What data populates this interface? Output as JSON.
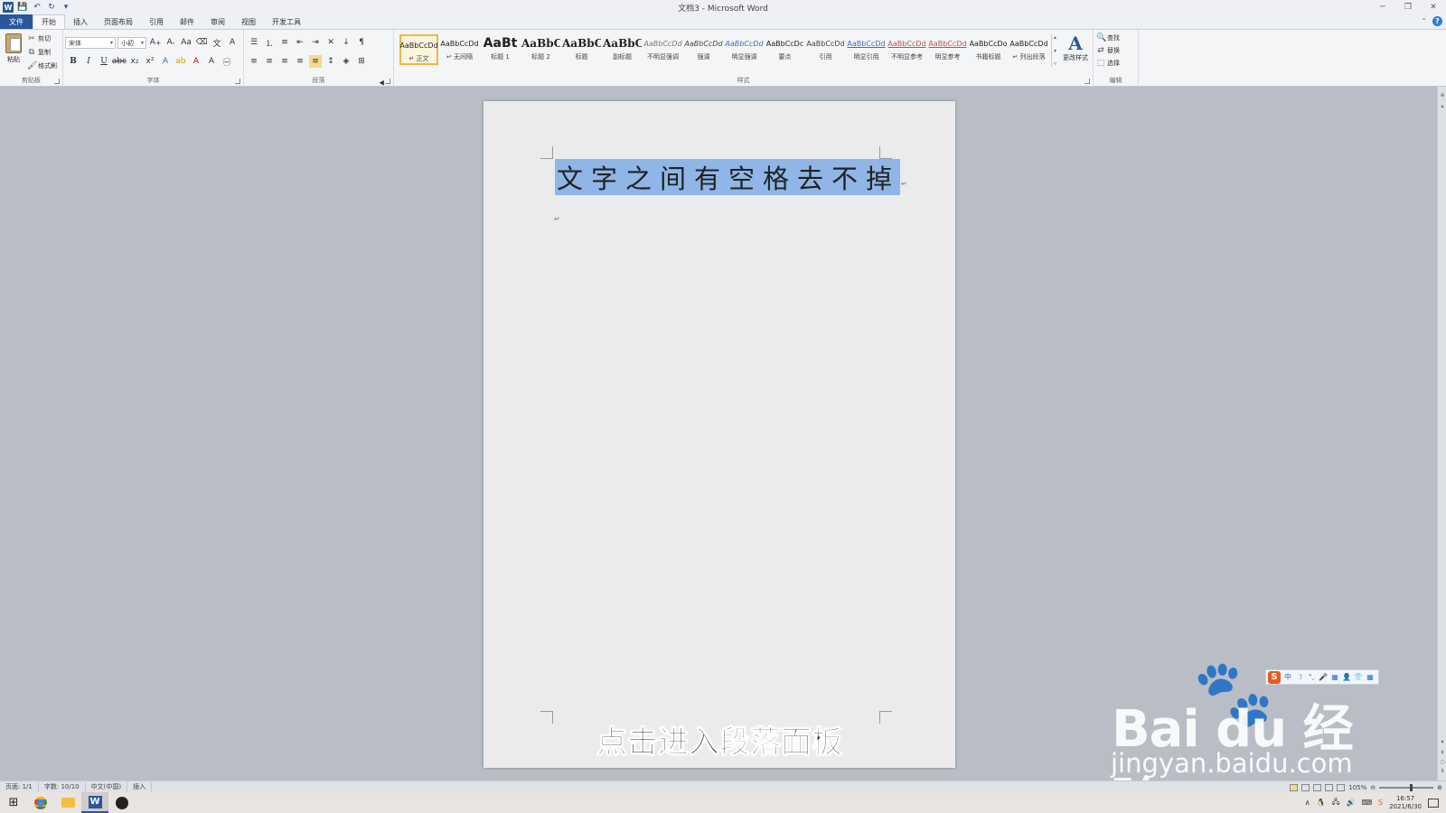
{
  "window": {
    "title": "文档3 - Microsoft Word",
    "controls": [
      "─",
      "❐",
      "✕"
    ]
  },
  "quick_access": [
    "W",
    "💾",
    "↶",
    "↻",
    "▾"
  ],
  "tabs": [
    {
      "label": "文件",
      "kind": "file"
    },
    {
      "label": "开始",
      "kind": "active"
    },
    {
      "label": "插入"
    },
    {
      "label": "页面布局"
    },
    {
      "label": "引用"
    },
    {
      "label": "邮件"
    },
    {
      "label": "审阅"
    },
    {
      "label": "视图"
    },
    {
      "label": "开发工具"
    }
  ],
  "ribbon": {
    "clipboard": {
      "label": "剪贴板",
      "paste": "粘贴",
      "cut": "剪切",
      "copy": "复制",
      "format_painter": "格式刷"
    },
    "font": {
      "label": "字体",
      "font_name": "宋体",
      "font_size": "小初"
    },
    "paragraph": {
      "label": "段落"
    },
    "styles": {
      "label": "样式",
      "items": [
        {
          "sample": "AaBbCcDd",
          "name": "↵ 正文",
          "selected": true,
          "color": "#222222"
        },
        {
          "sample": "AaBbCcDd",
          "name": "↵ 无间隔",
          "color": "#222222"
        },
        {
          "sample": "AaBt",
          "name": "标题 1",
          "color": "#222222"
        },
        {
          "sample": "AaBbC",
          "name": "标题 2",
          "color": "#222222"
        },
        {
          "sample": "AaBbC",
          "name": "标题",
          "color": "#222222"
        },
        {
          "sample": "AaBbC",
          "name": "副标题",
          "color": "#222222"
        },
        {
          "sample": "AaBbCcDd",
          "name": "不明显强调",
          "color": "#777777"
        },
        {
          "sample": "AaBbCcDd",
          "name": "强调",
          "color": "#444444"
        },
        {
          "sample": "AaBbCcDd",
          "name": "明显强调",
          "color": "#3b6fb6"
        },
        {
          "sample": "AaBbCcDc",
          "name": "要点",
          "color": "#222222"
        },
        {
          "sample": "AaBbCcDd",
          "name": "引用",
          "color": "#444444"
        },
        {
          "sample": "AaBbCcDd",
          "name": "明显引用",
          "color": "#3b6fb6"
        },
        {
          "sample": "AaBbCcDd",
          "name": "不明显参考",
          "color": "#c0504d"
        },
        {
          "sample": "AaBbCcDd",
          "name": "明显参考",
          "color": "#c0504d"
        },
        {
          "sample": "AaBbCcDo",
          "name": "书籍标题",
          "color": "#222222"
        },
        {
          "sample": "AaBbCcDd",
          "name": "↵ 列出段落",
          "color": "#222222"
        }
      ],
      "change_styles": "更改样式"
    },
    "editing": {
      "label": "编辑",
      "find": "查找",
      "replace": "替换",
      "select": "选择"
    }
  },
  "document": {
    "selected_text": "文字之间有空格去不掉",
    "paragraph_mark": "↵"
  },
  "subtitle": "点击进入段落面板",
  "ime_toolbar": [
    "中",
    "☽",
    "°,",
    "🎤",
    "▦",
    "👤",
    "👕",
    "▦"
  ],
  "watermark": {
    "brand": "Bai du 经验",
    "url": "jingyan.baidu.com"
  },
  "status_bar": {
    "page": "页面: 1/1",
    "words": "字数: 10/10",
    "language": "中文(中国)",
    "mode": "插入",
    "zoom": "105%"
  },
  "taskbar": {
    "time": "16:57",
    "date": "2021/6/30"
  },
  "colors": {
    "accent": "#2b579a",
    "selection": "#8fb6e6",
    "workspace": "#b9bec6",
    "style_selected_border": "#e8b84a"
  }
}
